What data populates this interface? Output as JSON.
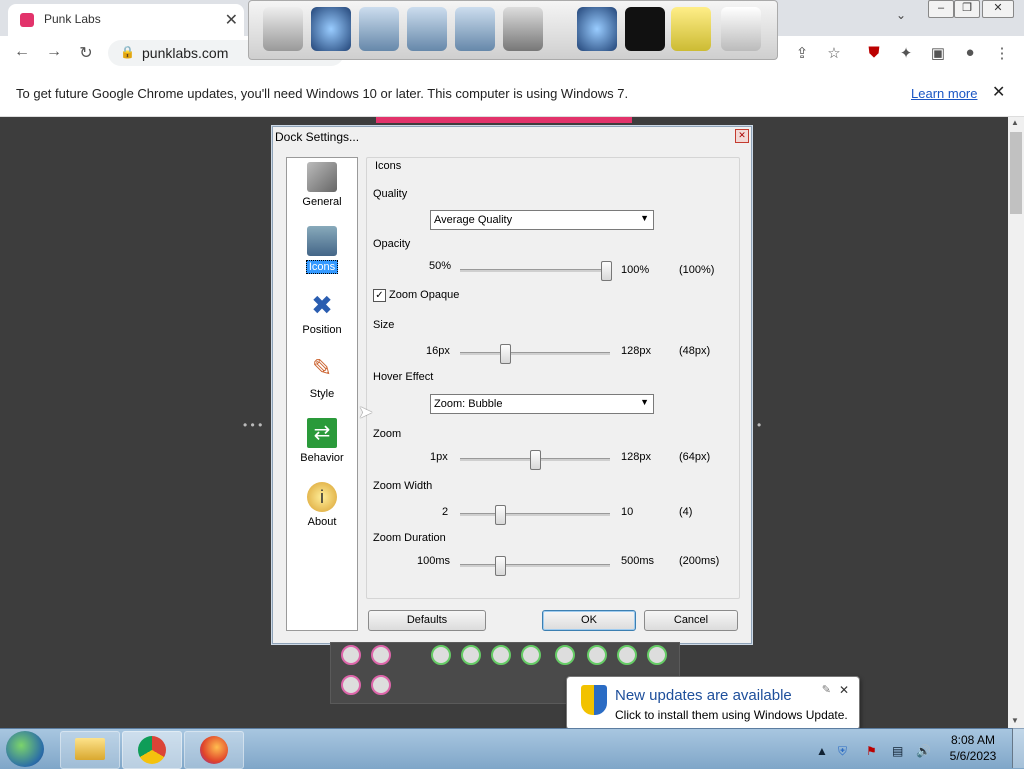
{
  "browser": {
    "tab_title": "Punk Labs",
    "url": "punklabs.com",
    "info_message": "To get future Google Chrome updates, you'll need Windows 10 or later. This computer is using Windows 7.",
    "learn_more": "Learn more"
  },
  "dialog": {
    "title": "Dock Settings...",
    "sidebar": [
      {
        "label": "General",
        "icon": "tools-icon"
      },
      {
        "label": "Icons",
        "icon": "cube-icon",
        "selected": true
      },
      {
        "label": "Position",
        "icon": "arrows-icon"
      },
      {
        "label": "Style",
        "icon": "brush-icon"
      },
      {
        "label": "Behavior",
        "icon": "switch-icon"
      },
      {
        "label": "About",
        "icon": "info-icon"
      }
    ],
    "group_title": "Icons",
    "quality": {
      "label": "Quality",
      "value": "Average Quality"
    },
    "opacity": {
      "label": "Opacity",
      "min": "50%",
      "max": "100%",
      "current": "(100%)",
      "fraction": 1.0
    },
    "zoom_opaque": {
      "label": "Zoom Opaque",
      "checked": true
    },
    "size": {
      "label": "Size",
      "min": "16px",
      "max": "128px",
      "current": "(48px)",
      "fraction": 0.29
    },
    "hover_effect": {
      "label": "Hover Effect",
      "value": "Zoom: Bubble"
    },
    "zoom": {
      "label": "Zoom",
      "min": "1px",
      "max": "128px",
      "current": "(64px)",
      "fraction": 0.5
    },
    "zoom_width": {
      "label": "Zoom Width",
      "min": "2",
      "max": "10",
      "current": "(4)",
      "fraction": 0.25
    },
    "zoom_duration": {
      "label": "Zoom Duration",
      "min": "100ms",
      "max": "500ms",
      "current": "(200ms)",
      "fraction": 0.25
    },
    "buttons": {
      "defaults": "Defaults",
      "ok": "OK",
      "cancel": "Cancel"
    }
  },
  "notification": {
    "title": "New updates are available",
    "subtitle": "Click to install them using Windows Update."
  },
  "clock": {
    "time": "8:08 AM",
    "date": "5/6/2023"
  }
}
